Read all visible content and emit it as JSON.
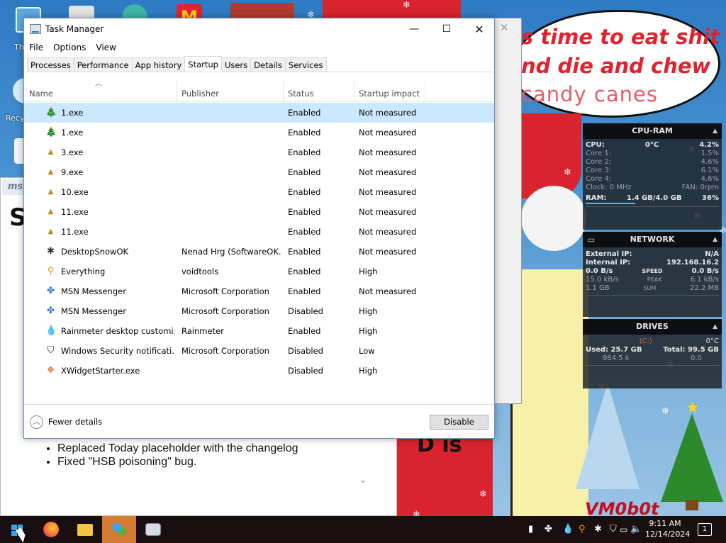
{
  "desktop": {
    "bubble_lines": [
      "s time to eat shit",
      "nd die and chew",
      "candy canes"
    ],
    "bg_page_header": "ms",
    "bg_page_letter": "S",
    "bg_page_list": [
      "Replaced Today placeholder with the changelog",
      "Fixed \"HSB poisoning\" bug."
    ],
    "sign_text": "D is",
    "signature": "VM0b0t",
    "icon_labels": [
      "Th",
      "Recy"
    ]
  },
  "rainmeter": {
    "cpu_ram": {
      "title": "CPU-RAM",
      "cpu_label": "CPU:",
      "temp": "0°C",
      "cpu_pct": "4.2%",
      "cores": [
        {
          "label": "Core 1:",
          "value": "1.5%"
        },
        {
          "label": "Core 2:",
          "value": "4.6%"
        },
        {
          "label": "Core 3:",
          "value": "6.1%"
        },
        {
          "label": "Core 4:",
          "value": "4.6%"
        }
      ],
      "clock": "Clock: 0 MHz",
      "fan": "FAN: 0rpm",
      "ram_label": "RAM:",
      "ram_value": "1.4 GB/4.0 GB",
      "ram_pct": "36%"
    },
    "network": {
      "title": "NETWORK",
      "external_label": "External IP:",
      "external_value": "N/A",
      "internal_label": "Internal IP:",
      "internal_value": "192.168.16.2",
      "speed_left": "0.0 B/s",
      "speed_label": "SPEED",
      "speed_right": "0.0 B/s",
      "peak_left": "15.0 kB/s",
      "peak_label": "PEAK",
      "peak_right": "6.1 kB/s",
      "sum_left": "1.1 GB",
      "sum_label": "SUM",
      "sum_right": "22.2 MB"
    },
    "drives": {
      "title": "DRIVES",
      "drive": "(C:)",
      "temp": "0°C",
      "used_label": "Used:",
      "used_value": "25.7 GB",
      "total_label": "Total:",
      "total_value": "99.5 GB",
      "read": "984.5 k",
      "write": "0.0"
    }
  },
  "taskmanager": {
    "title": "Task Manager",
    "controls": {
      "minimize": "—",
      "maximize": "☐",
      "close": "✕"
    },
    "menu": [
      "File",
      "Options",
      "View"
    ],
    "tabs": [
      "Processes",
      "Performance",
      "App history",
      "Startup",
      "Users",
      "Details",
      "Services"
    ],
    "active_tab": "Startup",
    "columns": {
      "name": "Name",
      "publisher": "Publisher",
      "status": "Status",
      "impact": "Startup impact"
    },
    "rows": [
      {
        "icon": "tree-icon",
        "glyph": "🎄",
        "name": "1.exe",
        "publisher": "",
        "status": "Enabled",
        "impact": "Not measured"
      },
      {
        "icon": "tree-icon",
        "glyph": "🎄",
        "name": "1.exe",
        "publisher": "",
        "status": "Enabled",
        "impact": "Not measured"
      },
      {
        "icon": "small-tree-icon",
        "glyph": "▲",
        "name": "3.exe",
        "publisher": "",
        "status": "Enabled",
        "impact": "Not measured"
      },
      {
        "icon": "small-tree-icon",
        "glyph": "▲",
        "name": "9.exe",
        "publisher": "",
        "status": "Enabled",
        "impact": "Not measured"
      },
      {
        "icon": "small-tree-icon",
        "glyph": "▲",
        "name": "10.exe",
        "publisher": "",
        "status": "Enabled",
        "impact": "Not measured"
      },
      {
        "icon": "small-tree-icon",
        "glyph": "▲",
        "name": "11.exe",
        "publisher": "",
        "status": "Enabled",
        "impact": "Not measured"
      },
      {
        "icon": "small-tree-icon",
        "glyph": "▲",
        "name": "11.exe",
        "publisher": "",
        "status": "Enabled",
        "impact": "Not measured"
      },
      {
        "icon": "snowflake-icon",
        "glyph": "✱",
        "name": "DesktopSnowOK",
        "publisher": "Nenad Hrg (SoftwareOK...",
        "status": "Enabled",
        "impact": "Not measured"
      },
      {
        "icon": "search-icon",
        "glyph": "⚲",
        "name": "Everything",
        "publisher": "voidtools",
        "status": "Enabled",
        "impact": "High"
      },
      {
        "icon": "msn-icon",
        "glyph": "✤",
        "name": "MSN Messenger",
        "publisher": "Microsoft Corporation",
        "status": "Enabled",
        "impact": "Not measured"
      },
      {
        "icon": "msn-icon",
        "glyph": "✤",
        "name": "MSN Messenger",
        "publisher": "Microsoft Corporation",
        "status": "Disabled",
        "impact": "High"
      },
      {
        "icon": "rainmeter-icon",
        "glyph": "💧",
        "name": "Rainmeter desktop customiz...",
        "publisher": "Rainmeter",
        "status": "Enabled",
        "impact": "High"
      },
      {
        "icon": "shield-icon",
        "glyph": "⛉",
        "name": "Windows Security notificati...",
        "publisher": "Microsoft Corporation",
        "status": "Disabled",
        "impact": "Low"
      },
      {
        "icon": "xwidget-icon",
        "glyph": "❖",
        "name": "XWidgetStarter.exe",
        "publisher": "",
        "status": "Disabled",
        "impact": "High"
      }
    ],
    "footer": {
      "fewer_details": "Fewer details",
      "disable_button": "Disable"
    }
  },
  "taskbar": {
    "items": [
      {
        "name": "start-button",
        "icon": "windows-logo-icon"
      },
      {
        "name": "firefox-button",
        "icon": "firefox-icon"
      },
      {
        "name": "file-explorer-button",
        "icon": "folder-icon"
      },
      {
        "name": "msn-messenger-button",
        "icon": "msn-icon"
      },
      {
        "name": "task-manager-button",
        "icon": "task-manager-icon"
      }
    ],
    "time": "9:11 AM",
    "date": "12/14/2024",
    "notification_count": "1"
  },
  "colors": {
    "selected_row": "#cce8ff",
    "taskbar_bg": "#1a0f10",
    "active_taskbar_item": "#d47c34",
    "bubble_text": "#e2222d"
  }
}
